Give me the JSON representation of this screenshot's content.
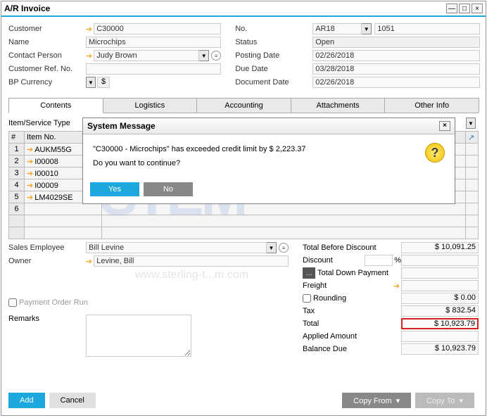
{
  "window": {
    "title": "A/R Invoice"
  },
  "header": {
    "left": {
      "customer_lbl": "Customer",
      "customer": "C30000",
      "name_lbl": "Name",
      "name": "Microchips",
      "contact_lbl": "Contact Person",
      "contact": "Judy Brown",
      "refno_lbl": "Customer Ref. No.",
      "bpcur_lbl": "BP Currency",
      "cur_sym": "$"
    },
    "right": {
      "no_lbl": "No.",
      "series": "AR18",
      "no": "1051",
      "status_lbl": "Status",
      "status": "Open",
      "posting_lbl": "Posting Date",
      "posting": "02/26/2018",
      "due_lbl": "Due Date",
      "due": "03/28/2018",
      "doc_lbl": "Document Date",
      "doc": "02/26/2018"
    }
  },
  "tabs": [
    "Contents",
    "Logistics",
    "Accounting",
    "Attachments",
    "Other Info"
  ],
  "grid": {
    "type_lbl": "Item/Service Type",
    "col1": "#",
    "col2": "Item No.",
    "rows": [
      {
        "n": "1",
        "item": "AUKM55G"
      },
      {
        "n": "2",
        "item": "I00008"
      },
      {
        "n": "3",
        "item": "I00010"
      },
      {
        "n": "4",
        "item": "I00009"
      },
      {
        "n": "5",
        "item": "LM4029SE"
      },
      {
        "n": "6",
        "item": ""
      }
    ]
  },
  "modal": {
    "title": "System Message",
    "line1": "\"C30000 - Microchips\" has exceeded credit limit by $ 2,223.37",
    "line2": "Do you want to continue?",
    "yes": "Yes",
    "no": "No"
  },
  "sales": {
    "emp_lbl": "Sales Employee",
    "emp": "Bill Levine",
    "owner_lbl": "Owner",
    "owner": "Levine, Bill",
    "payorder_lbl": "Payment Order Run",
    "remarks_lbl": "Remarks"
  },
  "totals": {
    "before_lbl": "Total Before Discount",
    "before": "$ 10,091.25",
    "discount_lbl": "Discount",
    "pct_sym": "%",
    "down_lbl": "Total Down Payment",
    "freight_lbl": "Freight",
    "rounding_lbl": "Rounding",
    "rounding": "$ 0.00",
    "tax_lbl": "Tax",
    "tax": "$ 832.54",
    "total_lbl": "Total",
    "total": "$ 10,923.79",
    "applied_lbl": "Applied Amount",
    "balance_lbl": "Balance Due",
    "balance": "$ 10,923.79"
  },
  "footer": {
    "add": "Add",
    "cancel": "Cancel",
    "copyfrom": "Copy From",
    "copyto": "Copy To"
  },
  "watermark": {
    "main": "STEM",
    "sub": "www.sterling-t...m.com",
    "reg": "®"
  }
}
